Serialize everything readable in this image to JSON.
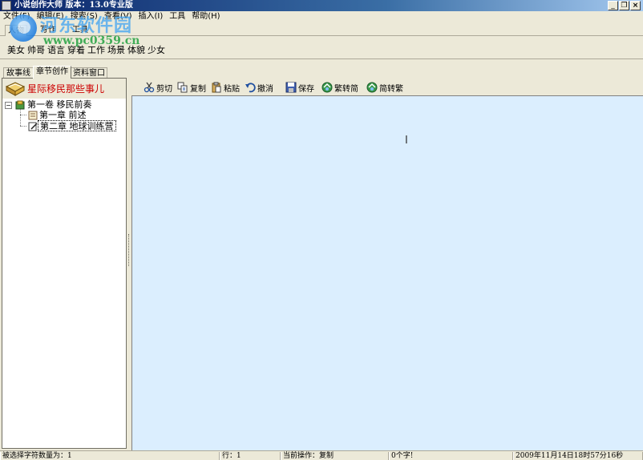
{
  "window": {
    "title": "小说创作大师 版本：13.0专业版",
    "minimize": "_",
    "restore": "❐",
    "close": "×"
  },
  "menu": [
    "文件(F)",
    "编辑(E)",
    "搜索(S)",
    "查看(V)",
    "插入(I)",
    "工具",
    "帮助(H)"
  ],
  "watermark": {
    "cn": "河东软件园",
    "url": "www.pc0359.cn"
  },
  "top_tabs": [
    "人物",
    "写作",
    "工具"
  ],
  "word_bar": [
    "美女",
    "帅哥",
    "语言",
    "穿着",
    "工作",
    "场景",
    "体貌",
    "少女"
  ],
  "left_tabs": [
    "故事线",
    "章节创作",
    "资料窗口"
  ],
  "story": {
    "title": "星际移民那些事儿",
    "tree": {
      "volume": "第一卷 移民前奏",
      "chapters": [
        "第一章 前述",
        "第二章 地球训练营"
      ]
    }
  },
  "toolbar": [
    {
      "label": "剪切",
      "icon": "scissors-icon"
    },
    {
      "label": "复制",
      "icon": "copy-icon"
    },
    {
      "label": "粘贴",
      "icon": "paste-icon"
    },
    {
      "label": "撤消",
      "icon": "undo-icon"
    },
    {
      "label": "保存",
      "icon": "save-icon"
    },
    {
      "label": "繁转简",
      "icon": "convert-icon"
    },
    {
      "label": "简转繁",
      "icon": "convert-icon"
    }
  ],
  "editor": {
    "content": "",
    "background": "#dbeefe"
  },
  "status": {
    "selected_chars": "被选择字符数量为：1",
    "line": "行：1",
    "current_op": "当前操作：复制",
    "char_count": "0个字!",
    "datetime": "2009年11月14日18时57分16秒"
  },
  "colors": {
    "title_gradient_start": "#0a246a",
    "story_title": "#cc0000",
    "editor_bg": "#dbeefe",
    "chrome": "#ece9d8"
  }
}
